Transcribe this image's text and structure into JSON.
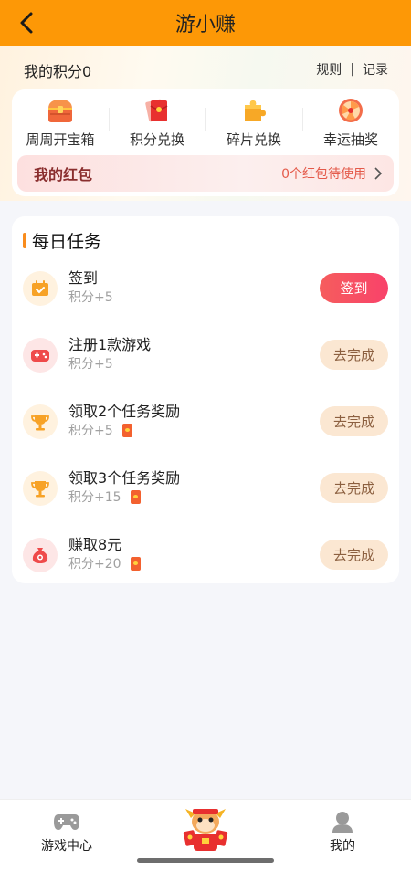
{
  "header": {
    "back_icon": "chevron-left-icon",
    "title": "游小赚",
    "bg_color": "#fd9806"
  },
  "points": {
    "label": "我的积分0",
    "rules_link": "规则",
    "separator": "|",
    "records_link": "记录"
  },
  "shortcuts": [
    {
      "label": "周周开宝箱",
      "icon": "treasure-chest-icon"
    },
    {
      "label": "积分兑换",
      "icon": "red-envelope-icon"
    },
    {
      "label": "碎片兑换",
      "icon": "puzzle-piece-icon"
    },
    {
      "label": "幸运抽奖",
      "icon": "lucky-wheel-icon"
    }
  ],
  "red_packet": {
    "title": "我的红包",
    "status": "0个红包待使用",
    "chevron_icon": "chevron-right-icon"
  },
  "daily_tasks": {
    "title": "每日任务",
    "items": [
      {
        "name": "签到",
        "points": "积分+5",
        "button": "签到",
        "icon": "calendar-check-icon",
        "has_redpacket": false,
        "primary": true
      },
      {
        "name": "注册1款游戏",
        "points": "积分+5",
        "button": "去完成",
        "icon": "gamepad-icon",
        "has_redpacket": false,
        "primary": false
      },
      {
        "name": "领取2个任务奖励",
        "points": "积分+5",
        "button": "去完成",
        "icon": "trophy-icon",
        "has_redpacket": true,
        "primary": false
      },
      {
        "name": "领取3个任务奖励",
        "points": "积分+15",
        "button": "去完成",
        "icon": "trophy-icon",
        "has_redpacket": true,
        "primary": false
      },
      {
        "name": "赚取8元",
        "points": "积分+20",
        "button": "去完成",
        "icon": "money-bag-icon",
        "has_redpacket": true,
        "primary": false
      }
    ]
  },
  "tabbar": {
    "items": [
      {
        "label": "游戏中心",
        "icon": "game-controller-icon"
      },
      {
        "label": "",
        "icon": "mascot-icon"
      },
      {
        "label": "我的",
        "icon": "user-icon"
      }
    ]
  },
  "colors": {
    "accent_orange": "#fd9806",
    "primary_button": "#f8426a",
    "secondary_button": "#fbe7d2"
  }
}
